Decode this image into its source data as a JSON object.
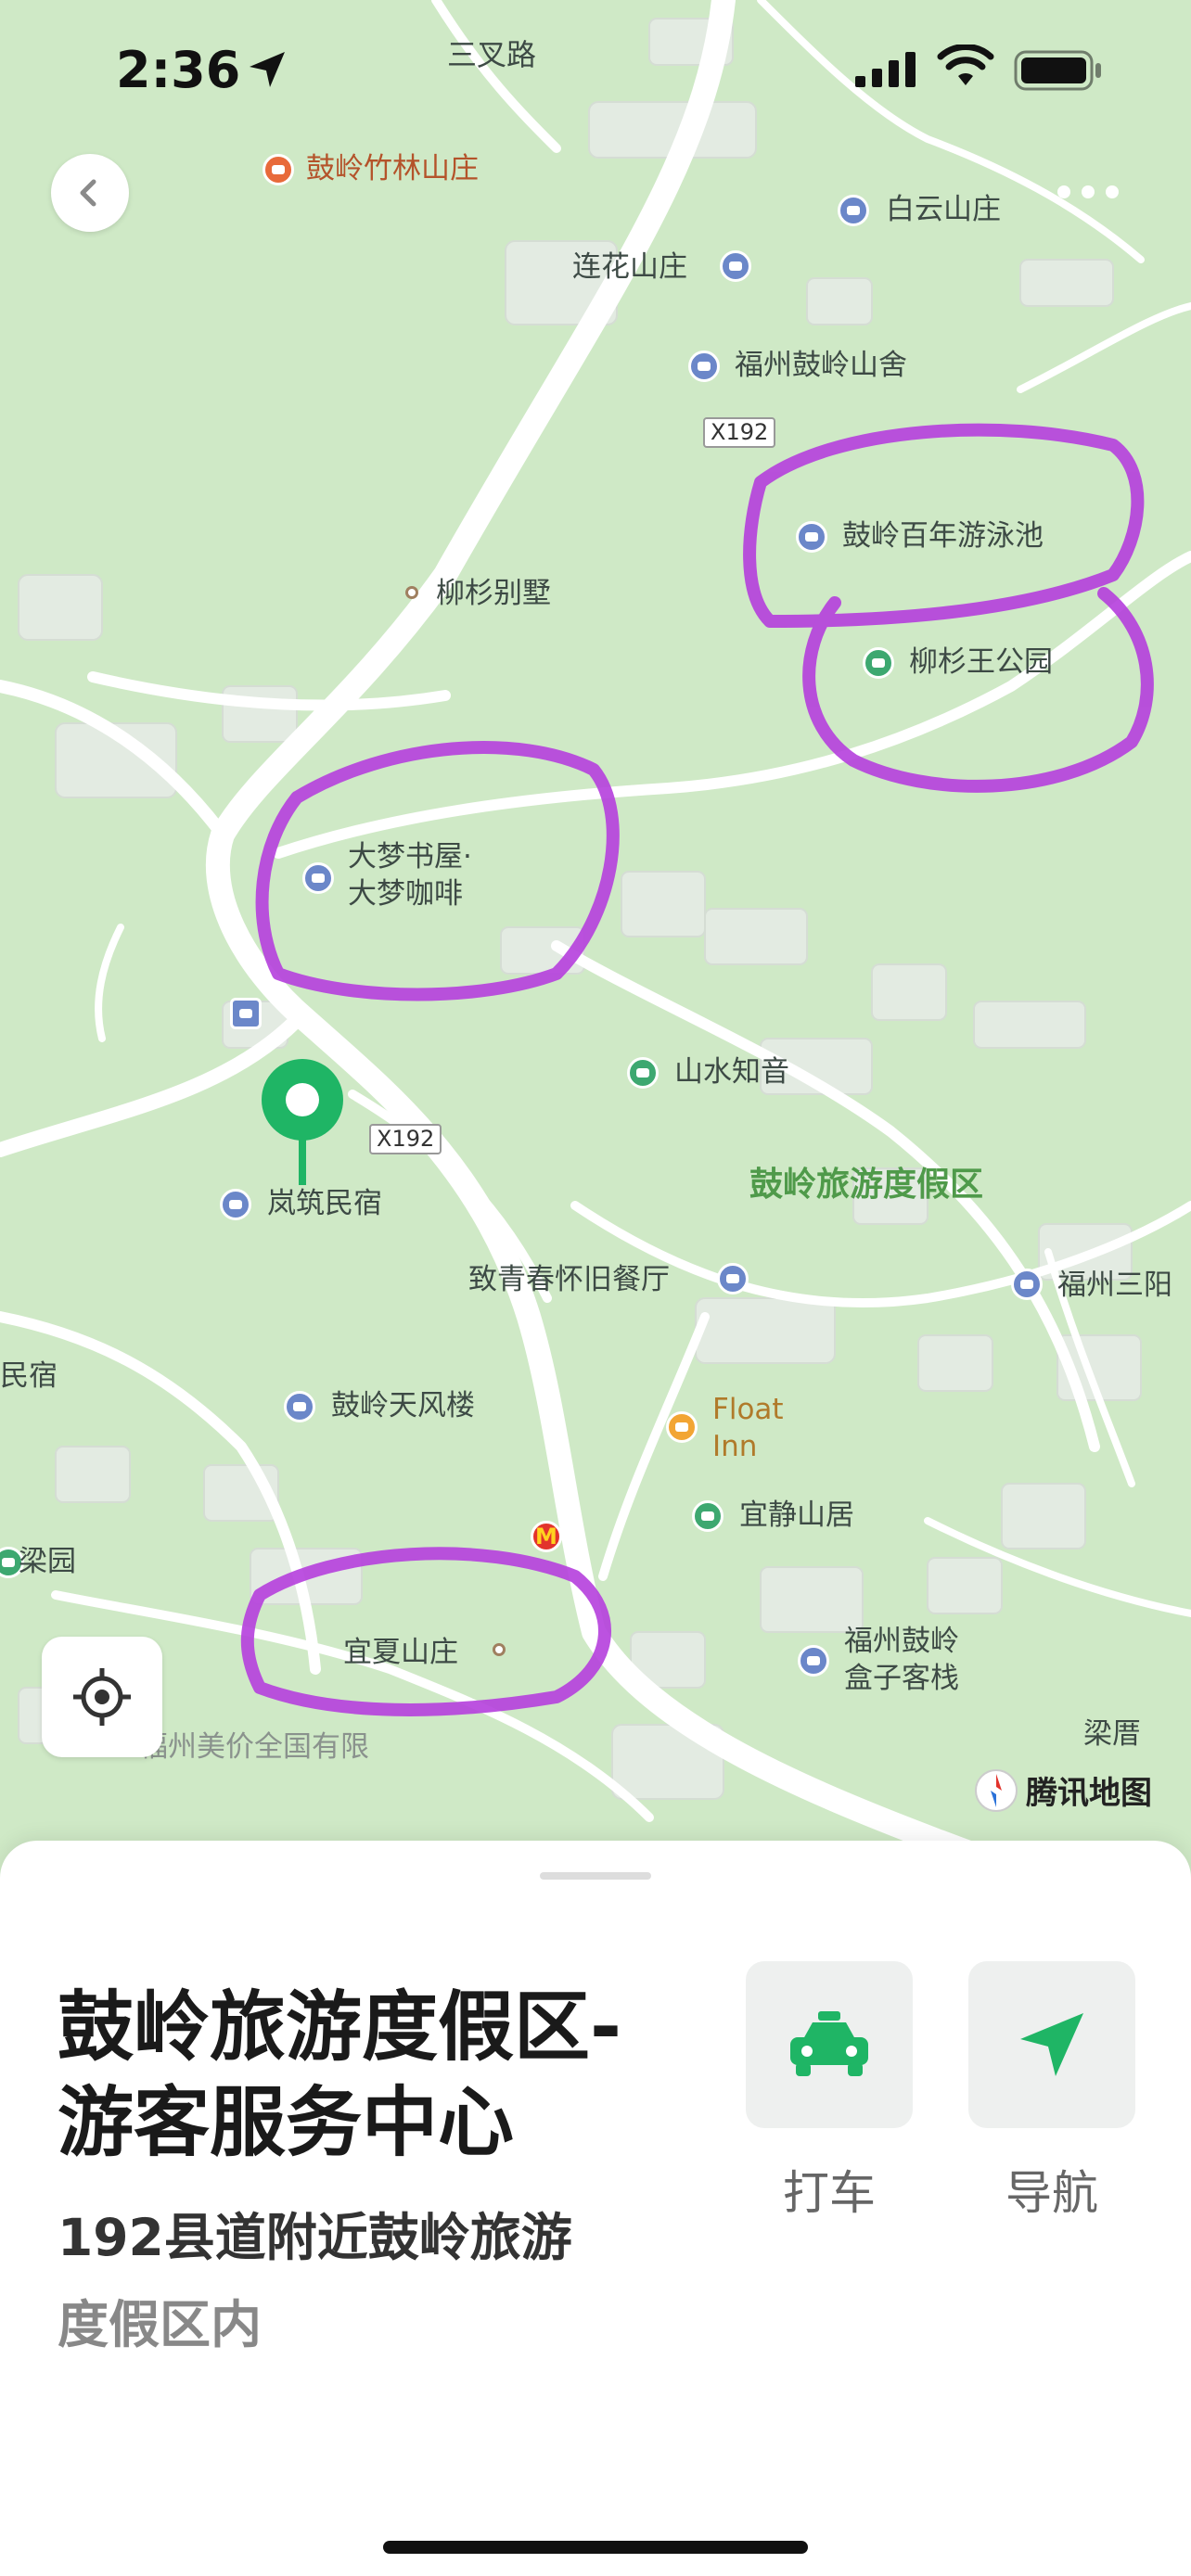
{
  "status": {
    "time": "2:36"
  },
  "map": {
    "labels": {
      "sancha_road": "三叉路",
      "guling_bamboo": "鼓岭竹林山庄",
      "baiyun": "白云山庄",
      "lianhua": "连花山庄",
      "fuzhou_guling_shanshe": "福州鼓岭山舍",
      "x192_top": "X192",
      "swimming_pool": "鼓岭百年游泳池",
      "liushan_villa": "柳杉别墅",
      "liushanwang_park": "柳杉王公园",
      "dameng_line1": "大梦书屋·",
      "dameng_line2": "大梦咖啡",
      "shanshui": "山水知音",
      "x192_mid": "X192",
      "resort": "鼓岭旅游度假区",
      "lanzhu": "岚筑民宿",
      "zhiqingchun": "致青春怀旧餐厅",
      "fuzhou_sanyang": "福州三阳",
      "minsu_left": "民宿",
      "tianfeng": "鼓岭天风楼",
      "float_inn_line1": "Float",
      "float_inn_line2": "Inn",
      "yijing": "宜静山居",
      "liangyuan": "梁园",
      "yixia": "宜夏山庄",
      "boxinn_line1": "福州鼓岭",
      "boxinn_line2": "盒子客栈",
      "liangcuo": "梁厝",
      "bottom_partial": "福州美价全国有限"
    },
    "brand": "腾讯地图",
    "colors": {
      "land": "#cfe9c6",
      "road": "#ffffff",
      "building": "#e4ece3",
      "highlight": "#b53fdd",
      "pin": "#1fb565"
    }
  },
  "sheet": {
    "title": "鼓岭旅游度假区-游客服务中心",
    "address_dark": "192县道附近鼓岭旅游",
    "address_grey": "度假区内",
    "actions": {
      "taxi": "打车",
      "navigate": "导航"
    }
  }
}
